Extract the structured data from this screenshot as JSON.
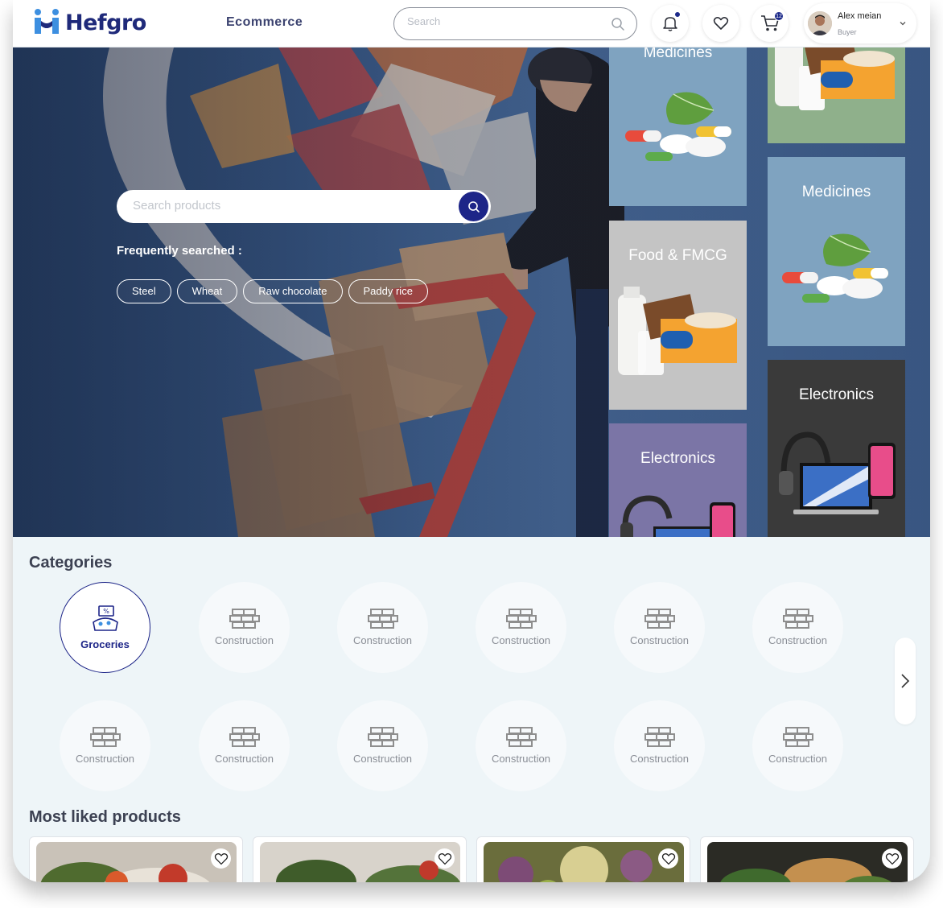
{
  "header": {
    "logo_text": "Hefgro",
    "nav_title": "Ecommerce",
    "search_placeholder": "Search",
    "cart_badge": "12",
    "user_name": "Alex meian",
    "user_role": "Buyer"
  },
  "hero": {
    "search_placeholder": "Search products",
    "frequently_label": "Frequently searched :",
    "chips": [
      "Steel",
      "Wheat",
      "Raw chocolate",
      "Paddy rice"
    ],
    "tiles": [
      "Medicines",
      "Food & FMCG",
      "Electronics",
      "Medicines",
      "Electronics"
    ]
  },
  "categories": {
    "title": "Categories",
    "items": [
      "Groceries",
      "Construction",
      "Construction",
      "Construction",
      "Construction",
      "Construction",
      "Construction",
      "Construction",
      "Construction",
      "Construction",
      "Construction",
      "Construction"
    ]
  },
  "products": {
    "title": "Most liked products"
  },
  "colors": {
    "brand": "#1d2588",
    "tile_blue": "#7fa3c0",
    "tile_green": "#8fb08b",
    "tile_gray": "#c4c4c4",
    "tile_purple": "#7b75a6",
    "tile_dark": "#3a3a3a"
  }
}
